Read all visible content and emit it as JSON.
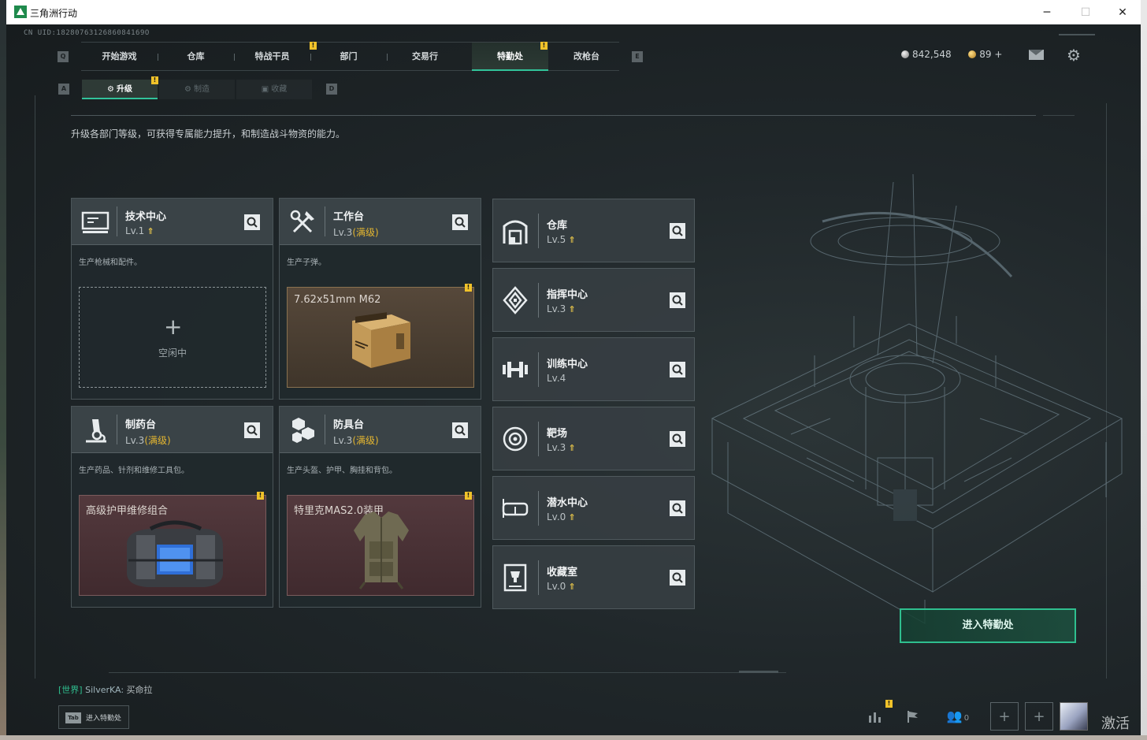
{
  "window": {
    "title": "三角洲行动",
    "controls": {
      "minimize": "─",
      "maximize": "☐",
      "close": "✕"
    }
  },
  "uid": "CN UID:1828076312686084169O",
  "main_nav": {
    "key_left": "Q",
    "key_right": "E",
    "tabs": [
      {
        "label": "开始游戏"
      },
      {
        "label": "仓库"
      },
      {
        "label": "特战干员"
      },
      {
        "label": "部门"
      },
      {
        "label": "交易行"
      },
      {
        "label": "特勤处",
        "active": true
      },
      {
        "label": "改枪台"
      }
    ],
    "badge_mark": "!"
  },
  "currency": {
    "silver": "842,548",
    "gold": "89 +"
  },
  "icons": {
    "mail": "mail-icon",
    "settings": "gear-icon",
    "settings_glyph": "⚙"
  },
  "sub_nav": {
    "key_left": "A",
    "key_right": "D",
    "tabs": [
      {
        "label": "升级",
        "active": true
      },
      {
        "label": "制造"
      },
      {
        "label": "收藏"
      }
    ]
  },
  "description": "升级各部门等级，可获得专属能力提升，和制造战斗物资的能力。",
  "facility_cards": [
    {
      "name": "技术中心",
      "level": "Lv.1",
      "max_tag": "",
      "upgrade_glyph": "⇑",
      "description": "生产枪械和配件。",
      "slot": {
        "type": "empty",
        "plus": "+",
        "status": "空闲中"
      }
    },
    {
      "name": "工作台",
      "level": "Lv.3",
      "max_tag": "(满级)",
      "upgrade_glyph": "",
      "description": "生产子弹。",
      "slot": {
        "type": "item",
        "title": "7.62x51mm M62",
        "badge": "!"
      }
    },
    {
      "name": "制药台",
      "level": "Lv.3",
      "max_tag": "(满级)",
      "upgrade_glyph": "",
      "description": "生产药品、针剂和维修工具包。",
      "slot": {
        "type": "item",
        "title": "高级护甲维修组合",
        "badge": "!"
      }
    },
    {
      "name": "防具台",
      "level": "Lv.3",
      "max_tag": "(满级)",
      "upgrade_glyph": "",
      "description": "生产头盔、护甲、胸挂和背包。",
      "slot": {
        "type": "item",
        "title": "特里克MAS2.0装甲",
        "badge": "!"
      }
    }
  ],
  "side_cards": [
    {
      "name": "仓库",
      "level": "Lv.5",
      "upgrade_glyph": "⇑"
    },
    {
      "name": "指挥中心",
      "level": "Lv.3",
      "upgrade_glyph": "⇑"
    },
    {
      "name": "训练中心",
      "level": "Lv.4",
      "upgrade_glyph": ""
    },
    {
      "name": "靶场",
      "level": "Lv.3",
      "upgrade_glyph": "⇑"
    },
    {
      "name": "潜水中心",
      "level": "Lv.0",
      "upgrade_glyph": "⇑"
    },
    {
      "name": "收藏室",
      "level": "Lv.0",
      "upgrade_glyph": "⇑"
    }
  ],
  "enter_button": "进入特勤处",
  "chat": {
    "channel": "[世界]",
    "user": "SilverKA:",
    "message": "买命拉"
  },
  "tab_hint": {
    "key": "Tab",
    "label": "进入特勤处"
  },
  "bottom_bar": {
    "friends_count": "0",
    "plus": "+",
    "badge": "!"
  },
  "watermark": "激活 W",
  "colors": {
    "accent": "#31c39a",
    "badge": "#f0c22a",
    "max_level": "#e4b630"
  }
}
